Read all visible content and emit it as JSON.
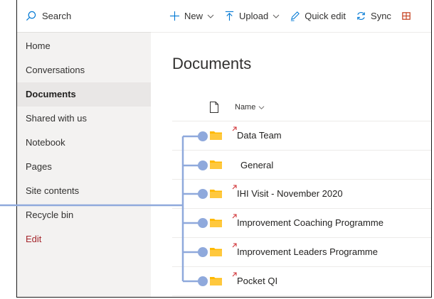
{
  "search": {
    "label": "Search",
    "icon": "search-icon"
  },
  "toolbar": {
    "new_label": "New",
    "upload_label": "Upload",
    "quick_edit_label": "Quick edit",
    "sync_label": "Sync"
  },
  "nav": {
    "items": [
      {
        "label": "Home"
      },
      {
        "label": "Conversations"
      },
      {
        "label": "Documents",
        "selected": true
      },
      {
        "label": "Shared with us"
      },
      {
        "label": "Notebook"
      },
      {
        "label": "Pages"
      },
      {
        "label": "Site contents"
      },
      {
        "label": "Recycle bin"
      },
      {
        "label": "Edit",
        "color": "#a4262c"
      }
    ]
  },
  "page": {
    "title": "Documents"
  },
  "list": {
    "name_header": "Name",
    "rows": [
      {
        "name": "Data Team",
        "is_new": true
      },
      {
        "name": "General",
        "is_new": false
      },
      {
        "name": "IHI Visit - November 2020",
        "is_new": true
      },
      {
        "name": "Improvement Coaching Programme",
        "is_new": true
      },
      {
        "name": "Improvement Leaders Programme",
        "is_new": true
      },
      {
        "name": "Pocket QI",
        "is_new": true
      }
    ]
  },
  "colors": {
    "accent": "#0078d4",
    "tree": "#8fa9dc",
    "folder": "#ffb900",
    "new_marker": "#d13438"
  }
}
